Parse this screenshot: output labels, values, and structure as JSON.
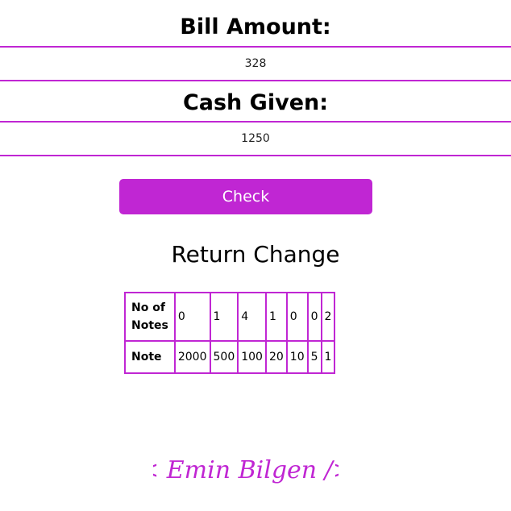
{
  "bill": {
    "label": "Bill Amount:",
    "value": "328"
  },
  "cash": {
    "label": "Cash Given:",
    "value": "1250"
  },
  "check_button": {
    "label": "Check"
  },
  "result": {
    "title": "Return Change",
    "row_headers": {
      "count": "No of Notes",
      "note": "Note"
    },
    "counts": [
      "0",
      "1",
      "4",
      "1",
      "0",
      "0",
      "2"
    ],
    "notes": [
      "2000",
      "500",
      "100",
      "20",
      "10",
      "5",
      "1"
    ]
  },
  "signature": {
    "text": "< Emin Bilgen />",
    "color": "#c026d3"
  },
  "colors": {
    "accent": "#c026d3"
  }
}
